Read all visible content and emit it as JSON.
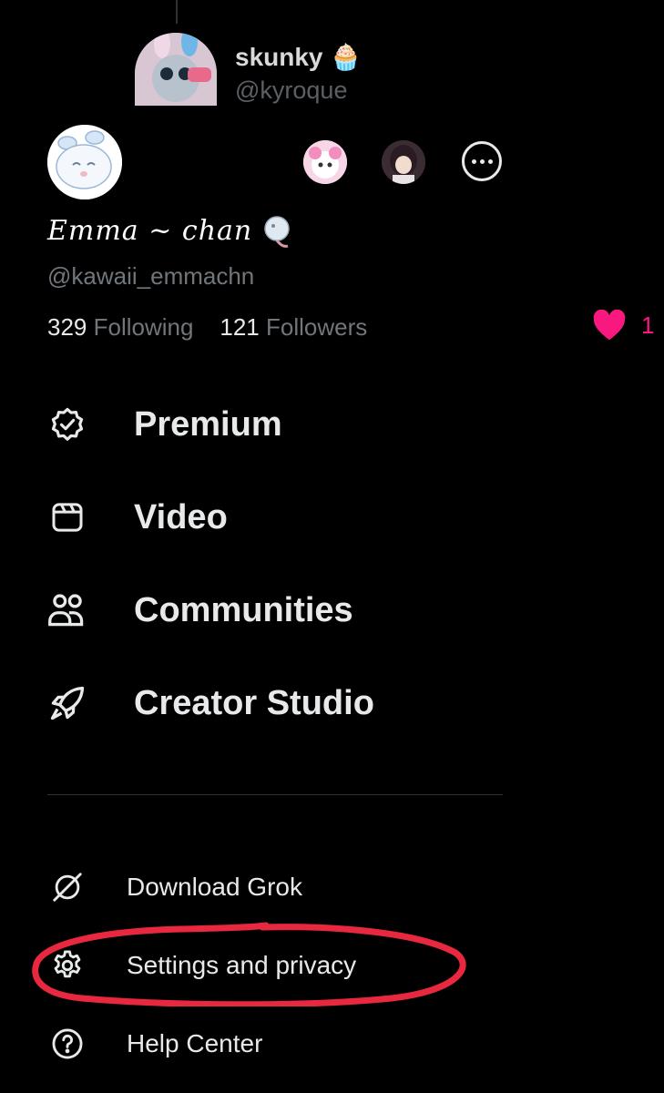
{
  "background": {
    "tweet": {
      "name": "skunky",
      "name_emoji": "🧁",
      "handle": "@kyroque"
    },
    "like_count": "1"
  },
  "profile": {
    "display_name": "Emma ~ chan",
    "handle": "@kawaii_emmachn",
    "following_count": "329",
    "following_label": "Following",
    "followers_count": "121",
    "followers_label": "Followers"
  },
  "menu": {
    "primary": [
      {
        "label": "Premium",
        "icon": "verified-badge-icon"
      },
      {
        "label": "Video",
        "icon": "video-icon"
      },
      {
        "label": "Communities",
        "icon": "communities-icon"
      },
      {
        "label": "Creator Studio",
        "icon": "rocket-icon"
      }
    ],
    "secondary": [
      {
        "label": "Download Grok",
        "icon": "grok-icon"
      },
      {
        "label": "Settings and privacy",
        "icon": "gear-icon"
      },
      {
        "label": "Help Center",
        "icon": "help-icon"
      }
    ]
  },
  "colors": {
    "background": "#000000",
    "text": "#e7e9ea",
    "muted": "#71767b",
    "like": "#f91880",
    "annotation": "#e8283f"
  }
}
